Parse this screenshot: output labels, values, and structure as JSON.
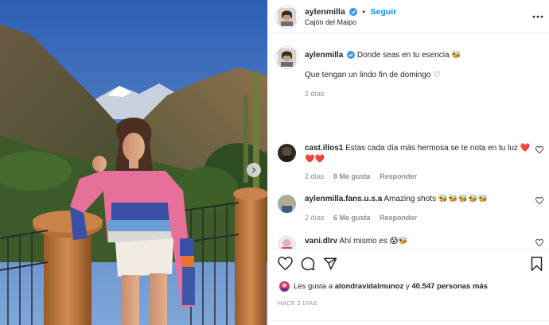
{
  "post": {
    "username": "aylenmilla",
    "follow_label": "Seguir",
    "separator": "•",
    "location": "Cajón del Maipo",
    "caption": {
      "line1": "Donde seas en tu esencia 🐝",
      "line2": "Que tengan un lindo fin de domingo ♡",
      "time": "2 días"
    }
  },
  "comments": [
    {
      "username": "cast.illos1",
      "text": "Estas cada día más hermosa se te nota en tu luz ❤️",
      "text2": "❤️❤️",
      "time": "2 días",
      "likes": "8 Me gusta",
      "reply": "Responder"
    },
    {
      "username": "aylenmilla.fans.u.s.a",
      "text": "Amazing shots 🐝🐝🐝🐝🐝",
      "time": "2 días",
      "likes": "6 Me gusta",
      "reply": "Responder"
    },
    {
      "username": "vani.dlrv",
      "text": "Ahí mismo es 😱🐝"
    }
  ],
  "likes_line": {
    "prefix": "Les gusta a",
    "user": "alondravidalmunoz",
    "middle": "y",
    "count": "40.547 personas más"
  },
  "posted_ago": "HACE 2 DÍAS",
  "icons": {
    "like": "heart-icon",
    "comment": "comment-icon",
    "share": "share-icon",
    "save": "bookmark-icon",
    "more": "more-options-icon",
    "verified": "verified-badge-icon",
    "next": "chevron-right-icon"
  },
  "colors": {
    "link_blue": "#0095f6",
    "verified_blue": "#3897f0",
    "muted": "#8e8e8e",
    "text": "#262626"
  }
}
